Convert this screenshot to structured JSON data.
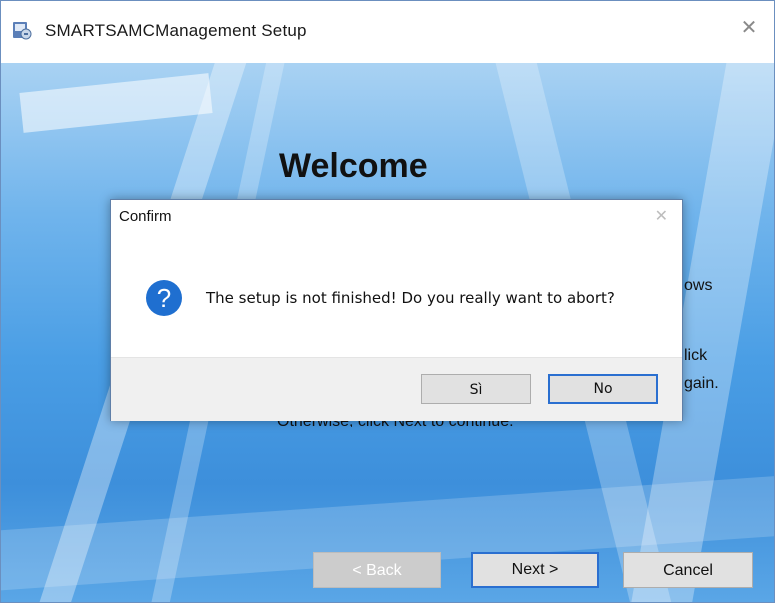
{
  "window": {
    "title": "SMARTSAMCManagement Setup",
    "close_glyph": "✕",
    "icon": "setup-app-icon"
  },
  "installer": {
    "heading": "Welcome",
    "fragments": {
      "ows": "ows",
      "lick": "lick",
      "gain": "gain.",
      "otherwise": "Otherwise, click Next to continue."
    },
    "buttons": {
      "back": "< Back",
      "next": "Next >",
      "cancel": "Cancel"
    }
  },
  "dialog": {
    "title": "Confirm",
    "close_glyph": "✕",
    "icon": "question-icon",
    "icon_glyph": "?",
    "message": "The setup is not finished! Do you really want to abort?",
    "buttons": {
      "yes": "Sì",
      "no": "No"
    }
  },
  "colors": {
    "accent": "#2a6fd0",
    "question_icon": "#1f6fd0"
  }
}
